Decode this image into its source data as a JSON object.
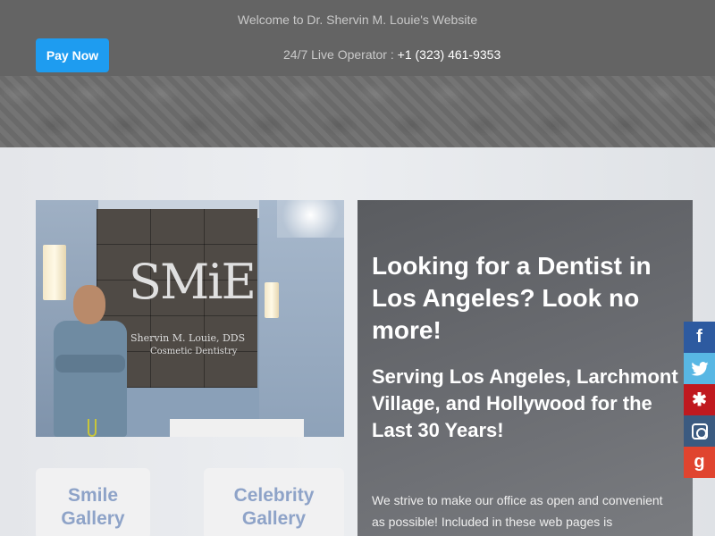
{
  "header": {
    "welcome": "Welcome to Dr. Shervin M. Louie's Website",
    "pay_now_label": "Pay Now",
    "operator_label": "24/7 Live Operator : ",
    "operator_phone": "+1 (323) 461-9353"
  },
  "hero_photo": {
    "logo_mark": "SMiE",
    "logo_name": "Shervin M. Louie, DDS",
    "logo_sub": "Cosmetic Dentistry"
  },
  "galleries": [
    {
      "label_line1": "Smile",
      "label_line2": "Gallery"
    },
    {
      "label_line1": "Celebrity",
      "label_line2": "Gallery"
    }
  ],
  "panel": {
    "heading": "Looking for a Dentist in Los Angeles? Look no more!",
    "subheading": "Serving Los Angeles, Larchmont Village, and Hollywood for the Last 30 Years!",
    "body": "We strive to make our office as open and convenient as possible! Included in these web pages is"
  },
  "social": [
    {
      "name": "facebook",
      "glyph": "f",
      "color": "#2d5aa0"
    },
    {
      "name": "twitter",
      "glyph": "🐦",
      "color": "#58b7e4"
    },
    {
      "name": "yelp",
      "glyph": "✱",
      "color": "#c0191f"
    },
    {
      "name": "instagram",
      "glyph": "",
      "color": "#3b5a80"
    },
    {
      "name": "google-plus",
      "glyph": "g",
      "color": "#e0442f"
    }
  ],
  "colors": {
    "topbar": "#646464",
    "pay_button": "#1e9cf0",
    "gallery_text": "#8ea3c8"
  }
}
